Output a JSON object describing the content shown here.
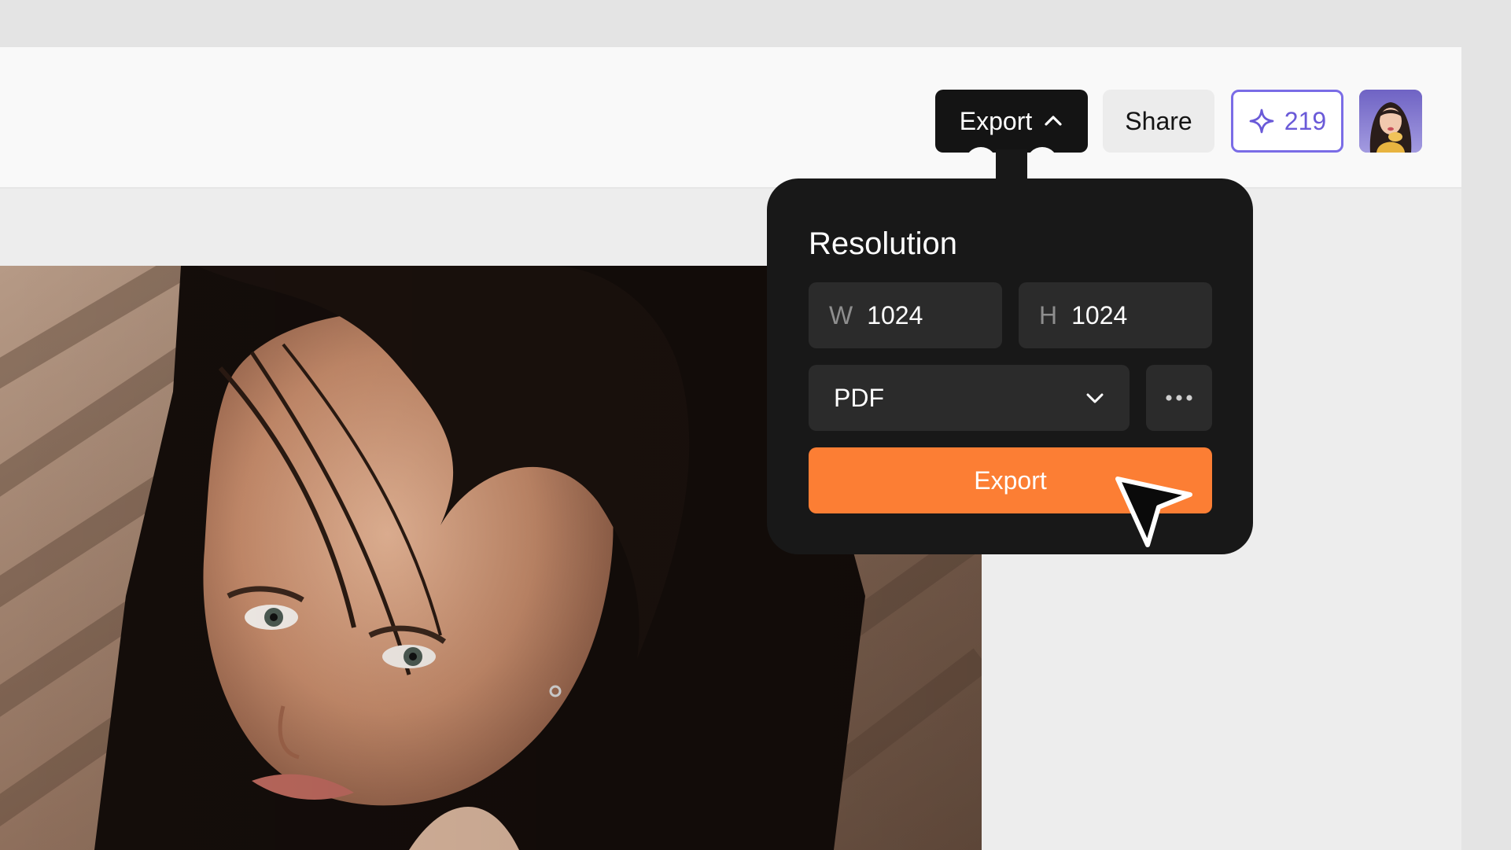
{
  "toolbar": {
    "export_label": "Export",
    "share_label": "Share",
    "credits_count": "219"
  },
  "export_panel": {
    "title": "Resolution",
    "width_prefix": "W",
    "width_value": "1024",
    "height_prefix": "H",
    "height_value": "1024",
    "format_value": "PDF",
    "export_button_label": "Export"
  },
  "icons": {
    "export_toggle": "chevron-up-icon",
    "credits": "sparkle-icon",
    "format_dropdown": "chevron-down-icon",
    "more": "ellipsis-icon",
    "pointer": "mouse-cursor-icon"
  },
  "colors": {
    "primary_accent": "#fc7e34",
    "credits_accent": "#7a6ce6",
    "panel_background": "#181818"
  }
}
